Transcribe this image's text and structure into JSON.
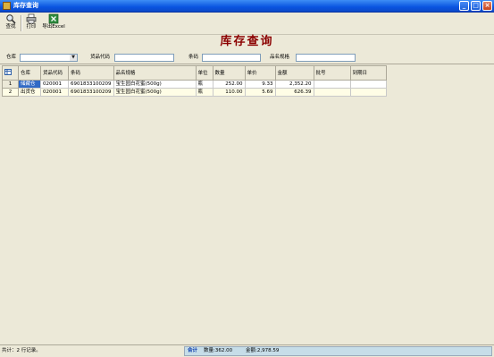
{
  "window": {
    "title": "库存查询",
    "buttons": {
      "minimize": "_",
      "maximize": "□",
      "close": "×"
    }
  },
  "toolbar": {
    "items": [
      {
        "label": "查找",
        "icon": "search-icon"
      },
      {
        "label": "打印",
        "icon": "printer-icon"
      },
      {
        "label": "导出Excel",
        "icon": "excel-icon"
      }
    ]
  },
  "page": {
    "heading": "库存查询"
  },
  "filters": {
    "warehouse_label": "仓库",
    "warehouse_value": "",
    "code_label": "货品代码",
    "code_value": "",
    "barcode_label": "条码",
    "barcode_value": "",
    "spec_label": "品名规格",
    "spec_value": ""
  },
  "table": {
    "columns": [
      "仓库",
      "货品代码",
      "条码",
      "品名规格",
      "单位",
      "数量",
      "单价",
      "金额",
      "批号",
      "到期日"
    ],
    "rows": [
      {
        "no": "1",
        "warehouse": "储藏仓",
        "code": "020001",
        "barcode": "6901833100209",
        "spec": "宝生园白花蜜(500g)",
        "unit": "瓶",
        "qty": "252.00",
        "price": "9.33",
        "amount": "2,352.20",
        "batch": "",
        "expiry": ""
      },
      {
        "no": "2",
        "warehouse": "出货仓",
        "code": "020001",
        "barcode": "6901833100209",
        "spec": "宝生园白花蜜(500g)",
        "unit": "瓶",
        "qty": "110.00",
        "price": "5.69",
        "amount": "626.39",
        "batch": "",
        "expiry": ""
      }
    ]
  },
  "status": {
    "record_count": "共计：2 行记录。",
    "total_label": "合计",
    "qty_total": "数量:362.00",
    "amount_total": "金额:2,978.59"
  },
  "colors": {
    "heading": "#8b0000",
    "titlebar": "#0a54e0",
    "selection": "#316ac5",
    "status_panel": "#c6dde8"
  }
}
